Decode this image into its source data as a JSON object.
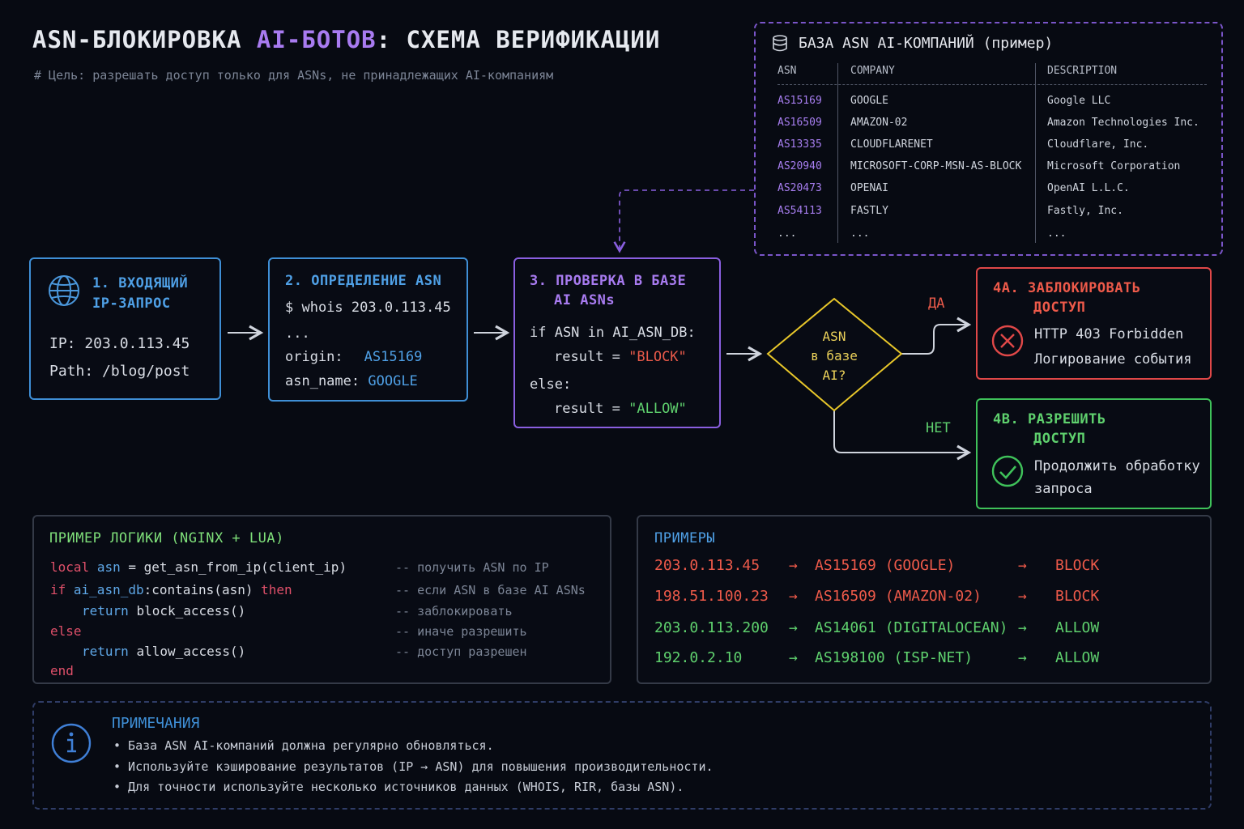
{
  "title": {
    "part1": "ASN-БЛОКИРОВКА ",
    "part2": "AI-БОТОВ",
    "part3": ": СХЕМА ВЕРИФИКАЦИИ"
  },
  "subtitle": "# Цель: разрешать доступ только для ASNs, не принадлежащих AI-компаниям",
  "db": {
    "title": "БАЗА ASN AI-КОМПАНИЙ (пример)",
    "icon": "database-icon",
    "columns": [
      "ASN",
      "COMPANY",
      "DESCRIPTION"
    ],
    "rows": [
      {
        "asn": "AS15169",
        "company": "GOOGLE",
        "description": "Google LLC"
      },
      {
        "asn": "AS16509",
        "company": "AMAZON-02",
        "description": "Amazon Technologies Inc."
      },
      {
        "asn": "AS13335",
        "company": "CLOUDFLARENET",
        "description": "Cloudflare, Inc."
      },
      {
        "asn": "AS20940",
        "company": "MICROSOFT-CORP-MSN-AS-BLOCK",
        "description": "Microsoft Corporation"
      },
      {
        "asn": "AS20473",
        "company": "OPENAI",
        "description": "OpenAI L.L.C."
      },
      {
        "asn": "AS54113",
        "company": "FASTLY",
        "description": "Fastly, Inc."
      },
      {
        "asn": "...",
        "company": "...",
        "description": "..."
      }
    ]
  },
  "step1": {
    "title_l1": "1. ВХОДЯЩИЙ",
    "title_l2": "IP-ЗАПРОС",
    "icon": "globe-icon",
    "ip": "IP: 203.0.113.45",
    "path": "Path: /blog/post"
  },
  "step2": {
    "title": "2. ОПРЕДЕЛЕНИЕ ASN",
    "cmd": "$ whois 203.0.113.45",
    "dots": "...",
    "origin_label": "origin:",
    "origin_value": "AS15169",
    "name_label": "asn_name:",
    "name_value": "GOOGLE"
  },
  "step3": {
    "title_l1": "3. ПРОВЕРКА В БАЗЕ",
    "title_l2": "AI ASNs",
    "if_line": "if ASN in AI_ASN_DB:",
    "res_label": "result = ",
    "block_val": "\"BLOCK\"",
    "else": "else:",
    "allow_val": "\"ALLOW\""
  },
  "decision": {
    "l1": "ASN",
    "l2": "в базе",
    "l3": "AI?",
    "yes": "ДА",
    "no": "НЕТ"
  },
  "block": {
    "title_l1": "4А. ЗАБЛОКИРОВАТЬ",
    "title_l2": "ДОСТУП",
    "icon": "x-circle-icon",
    "l1": "HTTP 403 Forbidden",
    "l2": "Логирование события"
  },
  "allow": {
    "title_l1": "4B. РАЗРЕШИТЬ",
    "title_l2": "ДОСТУП",
    "icon": "check-circle-icon",
    "l1": "Продолжить обработку",
    "l2": "запроса"
  },
  "code": {
    "title": "ПРИМЕР ЛОГИКИ (NGINX + LUA)",
    "lines": [
      {
        "kw": "local",
        "id": "asn",
        "rest": " = get_asn_from_ip(client_ip)",
        "comment": "-- получить ASN по IP"
      },
      {
        "kw": "if",
        "id": "ai_asn_db",
        "rest": ":contains(asn) ",
        "kw2": "then",
        "comment": "-- если ASN в базе AI ASNs"
      },
      {
        "kw": "return",
        "rest": "block_access()",
        "comment": "-- заблокировать"
      },
      {
        "kw": "else",
        "comment": "-- иначе разрешить"
      },
      {
        "kw": "return",
        "rest": "allow_access()",
        "comment": "-- доступ разрешен"
      },
      {
        "kw": "end"
      }
    ]
  },
  "examples": {
    "title": "ПРИМЕРЫ",
    "arrow": "→",
    "rows": [
      {
        "ip": "203.0.113.45",
        "asn": "AS15169 (GOOGLE)",
        "result": "BLOCK",
        "status": "block"
      },
      {
        "ip": "198.51.100.23",
        "asn": "AS16509 (AMAZON-02)",
        "result": "BLOCK",
        "status": "block"
      },
      {
        "ip": "203.0.113.200",
        "asn": "AS14061 (DIGITALOCEAN)",
        "result": "ALLOW",
        "status": "allow"
      },
      {
        "ip": "192.0.2.10",
        "asn": "AS198100 (ISP-NET)",
        "result": "ALLOW",
        "status": "allow"
      }
    ]
  },
  "notes": {
    "title": "ПРИМЕЧАНИЯ",
    "icon": "info-icon",
    "items": [
      "• База ASN AI-компаний должна регулярно обновляться.",
      "• Используйте кэширование результатов (IP → ASN) для повышения производительности.",
      "• Для точности используйте несколько источников данных (WHOIS, RIR, базы ASN)."
    ]
  },
  "colors": {
    "blue": "#3f8fd6",
    "purple": "#8a5fe0",
    "red": "#e04848",
    "green": "#3fc25a",
    "yellow": "#e8c72a"
  }
}
